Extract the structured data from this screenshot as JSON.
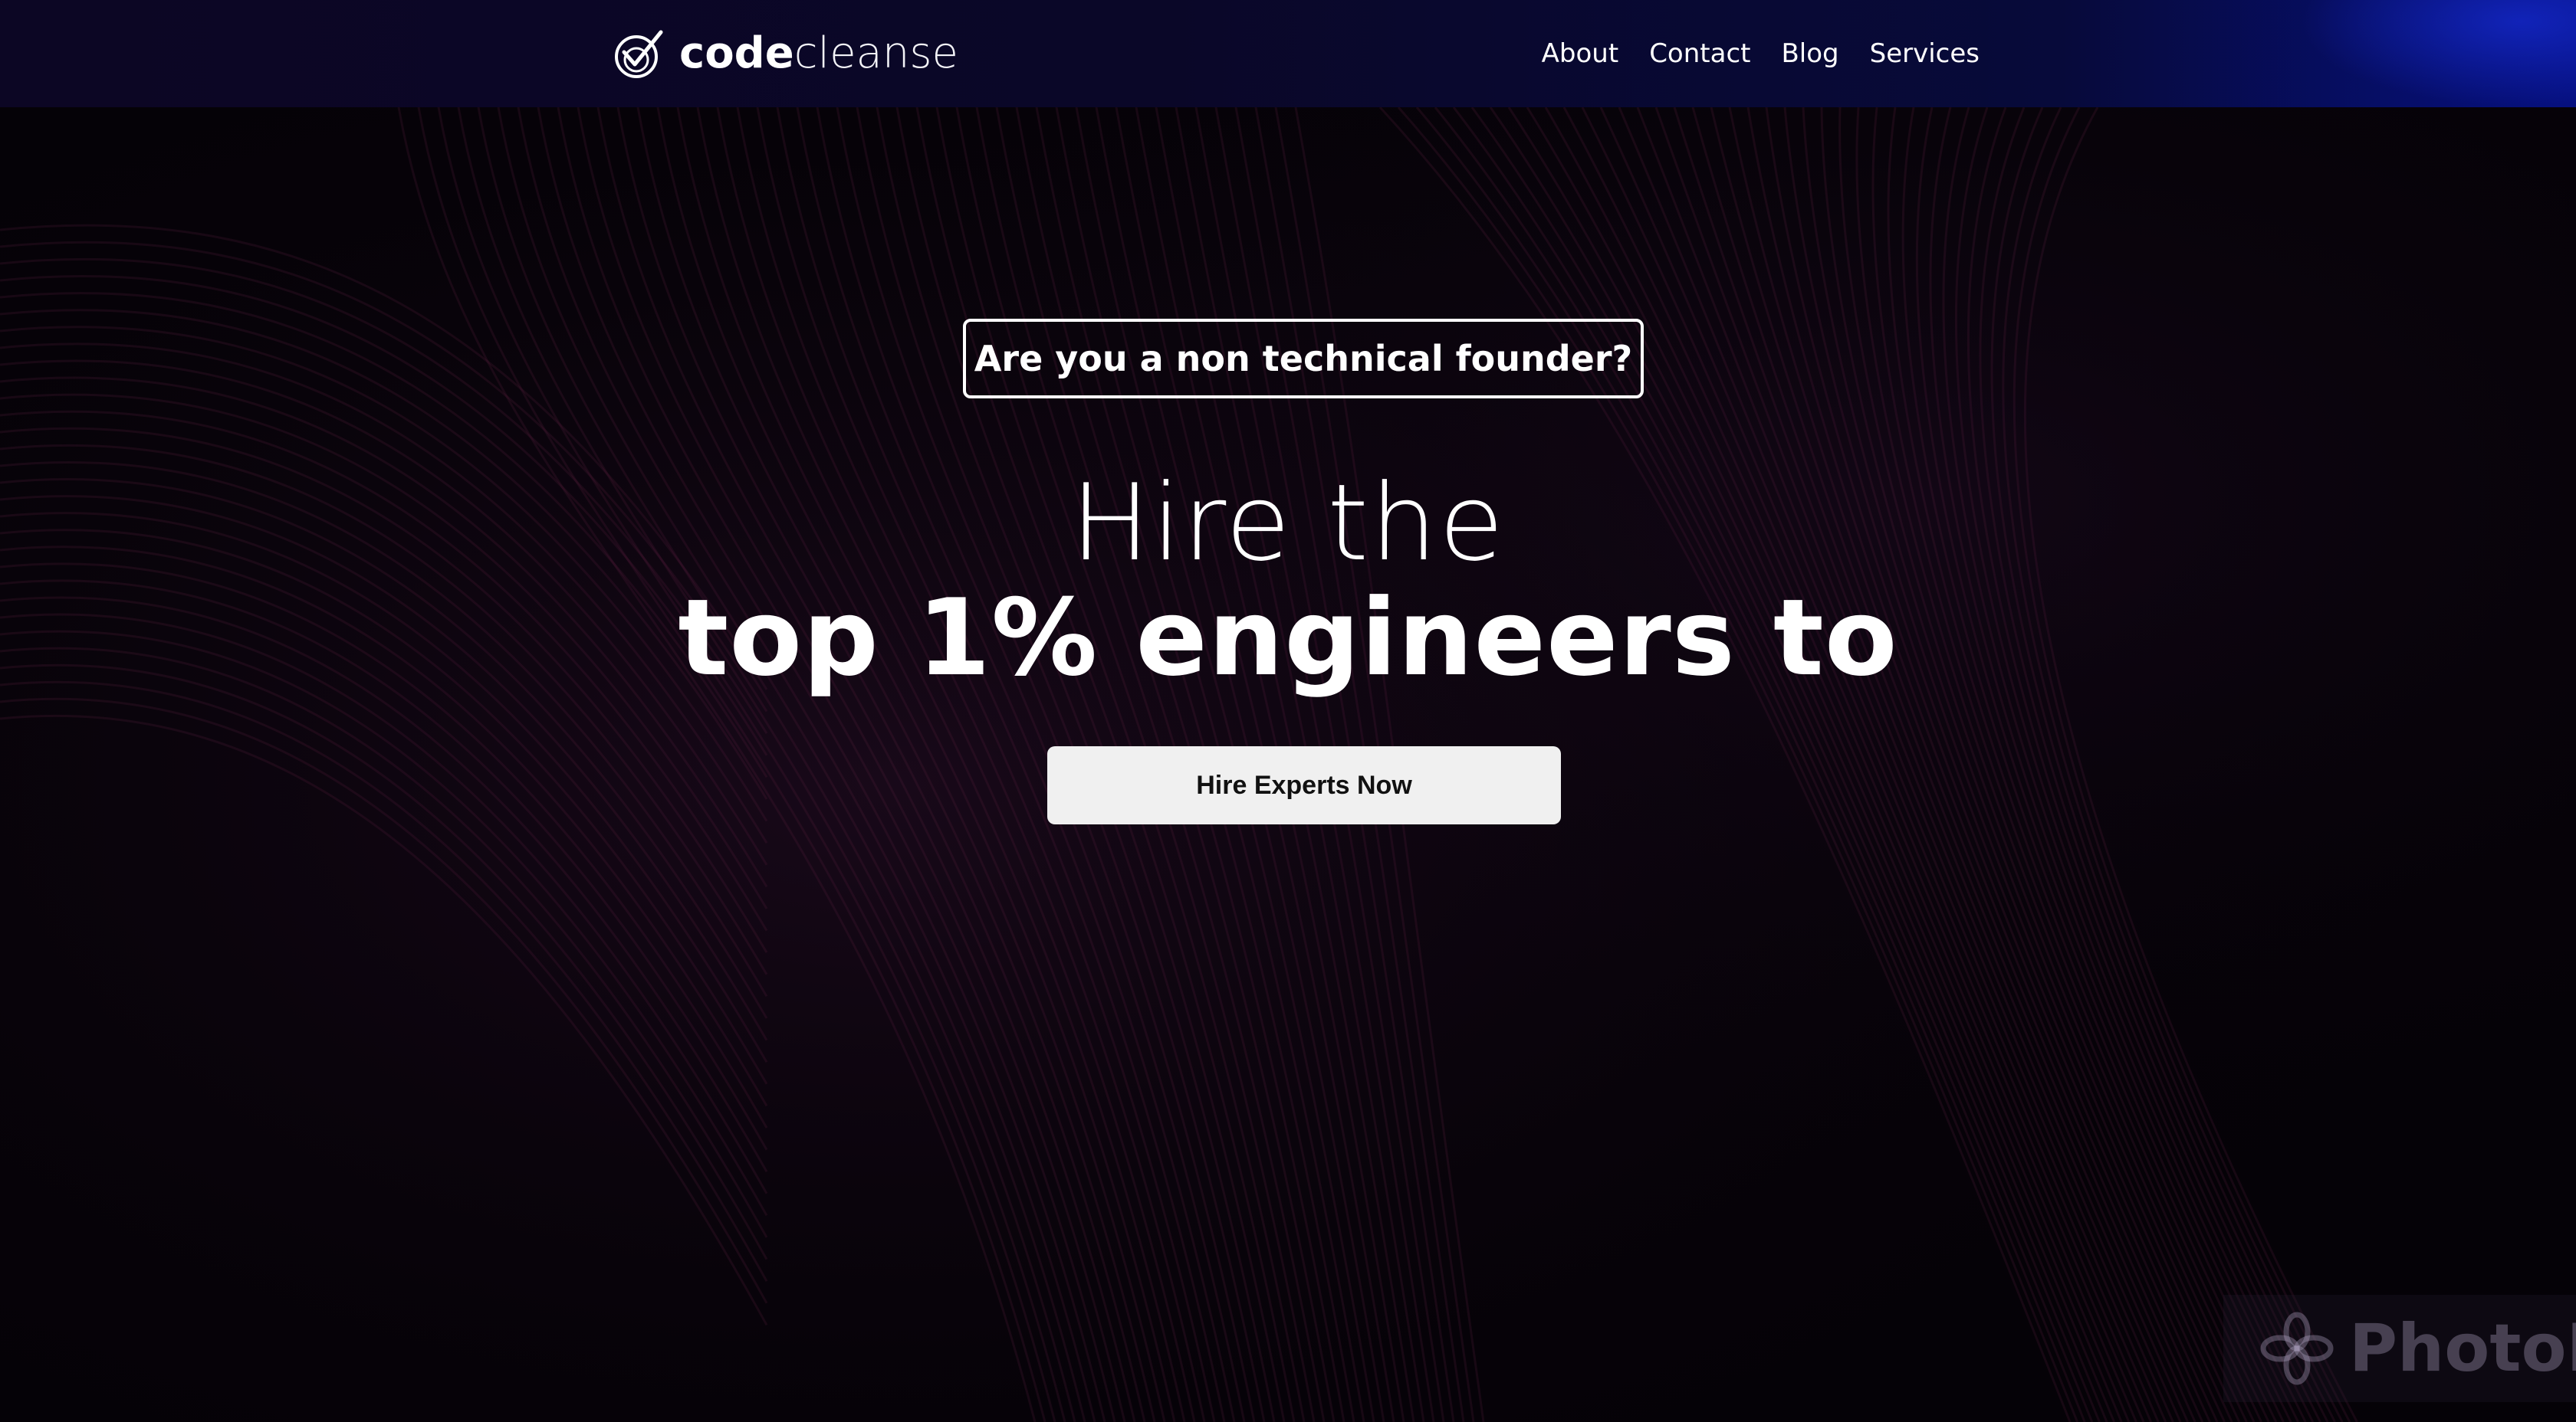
{
  "header": {
    "brand": {
      "bold": "code",
      "light": "cleanse"
    },
    "nav": [
      "About",
      "Contact",
      "Blog",
      "Services"
    ]
  },
  "hero": {
    "eyebrow": "Are you a non technical founder?",
    "headline_line1": "Hire the",
    "headline_line2": "top 1% engineers to",
    "cta_label": "Hire Experts Now"
  },
  "watermark": {
    "text": "PhotoM"
  },
  "colors": {
    "background": "#050207",
    "header": "#0c0624",
    "accent_blue": "#061080",
    "text": "#ffffff",
    "cta_background": "#f0f0f0",
    "cta_text": "#111111"
  },
  "icons": {
    "brand": "check-swirl-icon",
    "watermark": "flower-icon"
  }
}
